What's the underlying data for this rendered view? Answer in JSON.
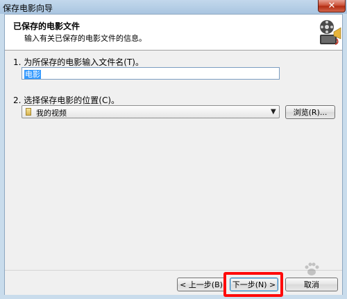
{
  "window": {
    "title": "保存电影向导",
    "close_label": "✕"
  },
  "header": {
    "title": "已保存的电影文件",
    "subtitle": "输入有关已保存的电影文件的信息。",
    "icon": "film-reel-icon"
  },
  "step1": {
    "label": "1. 为所保存的电影输入文件名(T)。",
    "filename_value": "电影"
  },
  "step2": {
    "label": "2. 选择保存电影的位置(C)。",
    "location_value": "我的视频",
    "browse_label": "浏览(R)..."
  },
  "footer": {
    "back_label": "< 上一步(B)",
    "next_label": "下一步(N) >",
    "cancel_label": "取消"
  },
  "colors": {
    "highlight": "#ff0a0a",
    "selection": "#3399ff"
  }
}
